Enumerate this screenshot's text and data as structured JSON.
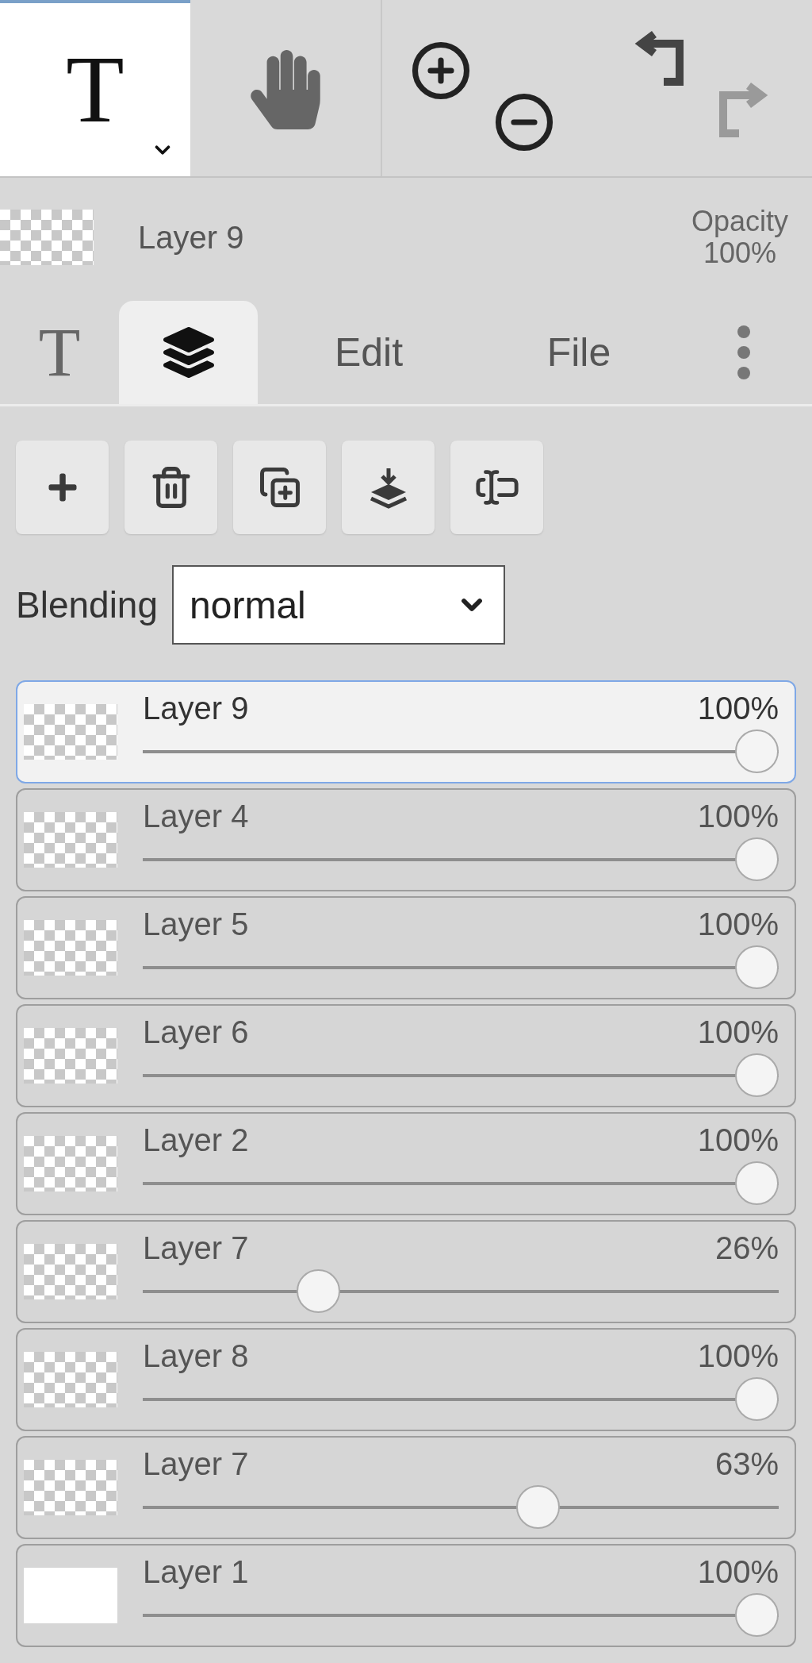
{
  "toolbar": {
    "tools": [
      {
        "kind": "text",
        "label": "T",
        "selected": true
      },
      {
        "kind": "hand",
        "selected": false
      }
    ],
    "history": [
      {
        "kind": "undo",
        "disabled": false
      },
      {
        "kind": "redo",
        "disabled": true
      }
    ]
  },
  "current_layer": {
    "name": "Layer 9",
    "opacity_label": "Opacity",
    "opacity": "100%"
  },
  "tabs": [
    {
      "kind": "text",
      "label": "T",
      "selected": false
    },
    {
      "kind": "layers",
      "selected": true
    },
    {
      "kind": "label",
      "label": "Edit",
      "selected": false
    },
    {
      "kind": "label",
      "label": "File",
      "selected": false
    },
    {
      "kind": "more",
      "selected": false
    }
  ],
  "layer_actions": [
    {
      "kind": "add"
    },
    {
      "kind": "delete"
    },
    {
      "kind": "duplicate"
    },
    {
      "kind": "merge"
    },
    {
      "kind": "rename"
    }
  ],
  "blending": {
    "label": "Blending",
    "value": "normal"
  },
  "layers": [
    {
      "name": "Layer 9",
      "opacity": "100%",
      "level": 1,
      "selected": true,
      "kind": "transparent"
    },
    {
      "name": "Layer 4",
      "opacity": "100%",
      "level": 1,
      "selected": false,
      "kind": "transparent"
    },
    {
      "name": "Layer 5",
      "opacity": "100%",
      "level": 1,
      "selected": false,
      "kind": "transparent"
    },
    {
      "name": "Layer 6",
      "opacity": "100%",
      "level": 1,
      "selected": false,
      "kind": "transparent"
    },
    {
      "name": "Layer 2",
      "opacity": "100%",
      "level": 1,
      "selected": false,
      "kind": "transparent"
    },
    {
      "name": "Layer 7",
      "opacity": "26%",
      "level": 0.26,
      "selected": false,
      "kind": "transparent"
    },
    {
      "name": "Layer 8",
      "opacity": "100%",
      "level": 1,
      "selected": false,
      "kind": "transparent"
    },
    {
      "name": "Layer 7",
      "opacity": "63%",
      "level": 0.63,
      "selected": false,
      "kind": "transparent"
    },
    {
      "name": "Layer 1",
      "opacity": "100%",
      "level": 1,
      "selected": false,
      "kind": "white"
    }
  ]
}
